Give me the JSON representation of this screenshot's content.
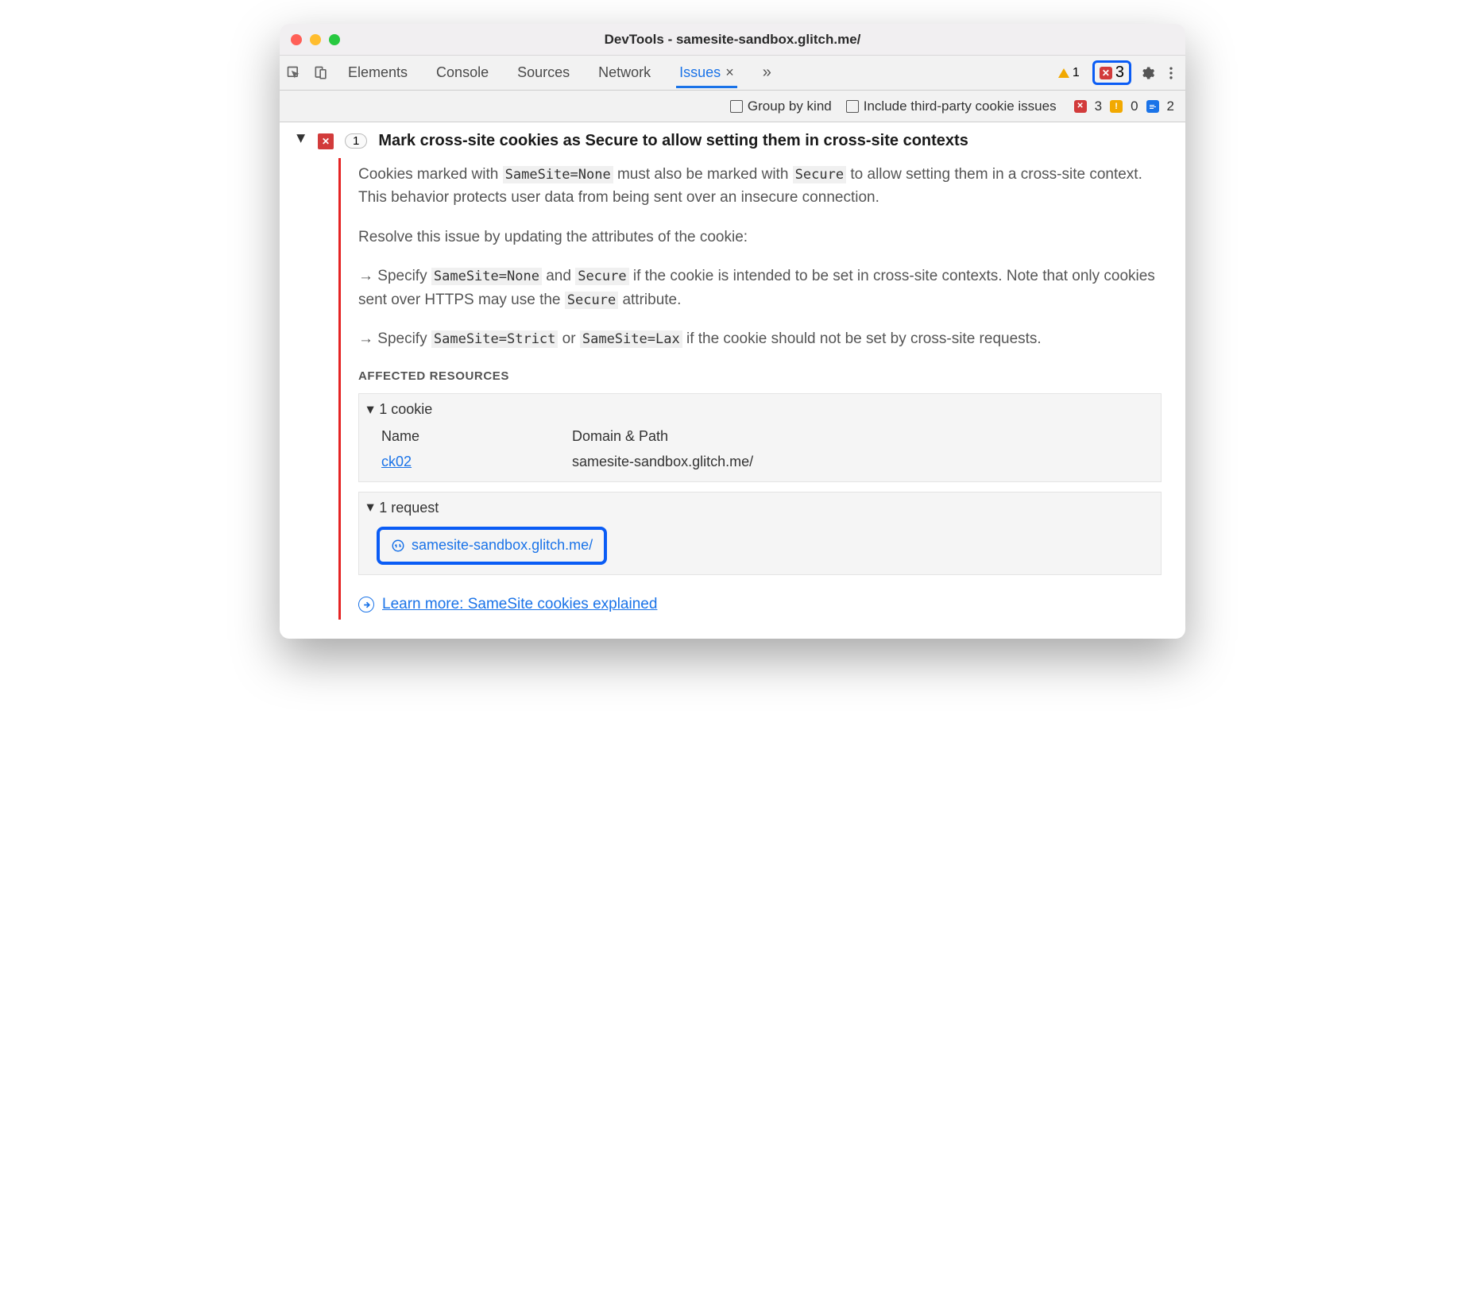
{
  "title": "DevTools - samesite-sandbox.glitch.me/",
  "tabs": {
    "elements": "Elements",
    "console": "Console",
    "sources": "Sources",
    "network": "Network",
    "issues": "Issues",
    "close": "×",
    "more": "»"
  },
  "top_counters": {
    "warn": "1",
    "err": "3"
  },
  "options": {
    "group": "Group by kind",
    "thirdparty": "Include third-party cookie issues"
  },
  "issue_counters": {
    "err": "3",
    "warn": "0",
    "info": "2"
  },
  "issue": {
    "count": "1",
    "title": "Mark cross-site cookies as Secure to allow setting them in cross-site contexts",
    "p1a": "Cookies marked with ",
    "c1": "SameSite=None",
    "p1b": " must also be marked with ",
    "c2": "Secure",
    "p1c": " to allow setting them in a cross-site context. This behavior protects user data from being sent over an insecure connection.",
    "p2": "Resolve this issue by updating the attributes of the cookie:",
    "b1a": "Specify ",
    "c3": "SameSite=None",
    "b1b": " and ",
    "c4": "Secure",
    "b1c": " if the cookie is intended to be set in cross-site contexts. Note that only cookies sent over HTTPS may use the ",
    "c5": "Secure",
    "b1d": " attribute.",
    "b2a": "Specify ",
    "c6": "SameSite=Strict",
    "b2b": " or ",
    "c7": "SameSite=Lax",
    "b2c": " if the cookie should not be set by cross-site requests.",
    "affected_h": "Affected Resources",
    "cookie_h": "1 cookie",
    "col_name": "Name",
    "col_domain": "Domain & Path",
    "cookie_name": "ck02",
    "cookie_domain": "samesite-sandbox.glitch.me/",
    "request_h": "1 request",
    "request_url": "samesite-sandbox.glitch.me/",
    "learn": "Learn more: SameSite cookies explained"
  }
}
